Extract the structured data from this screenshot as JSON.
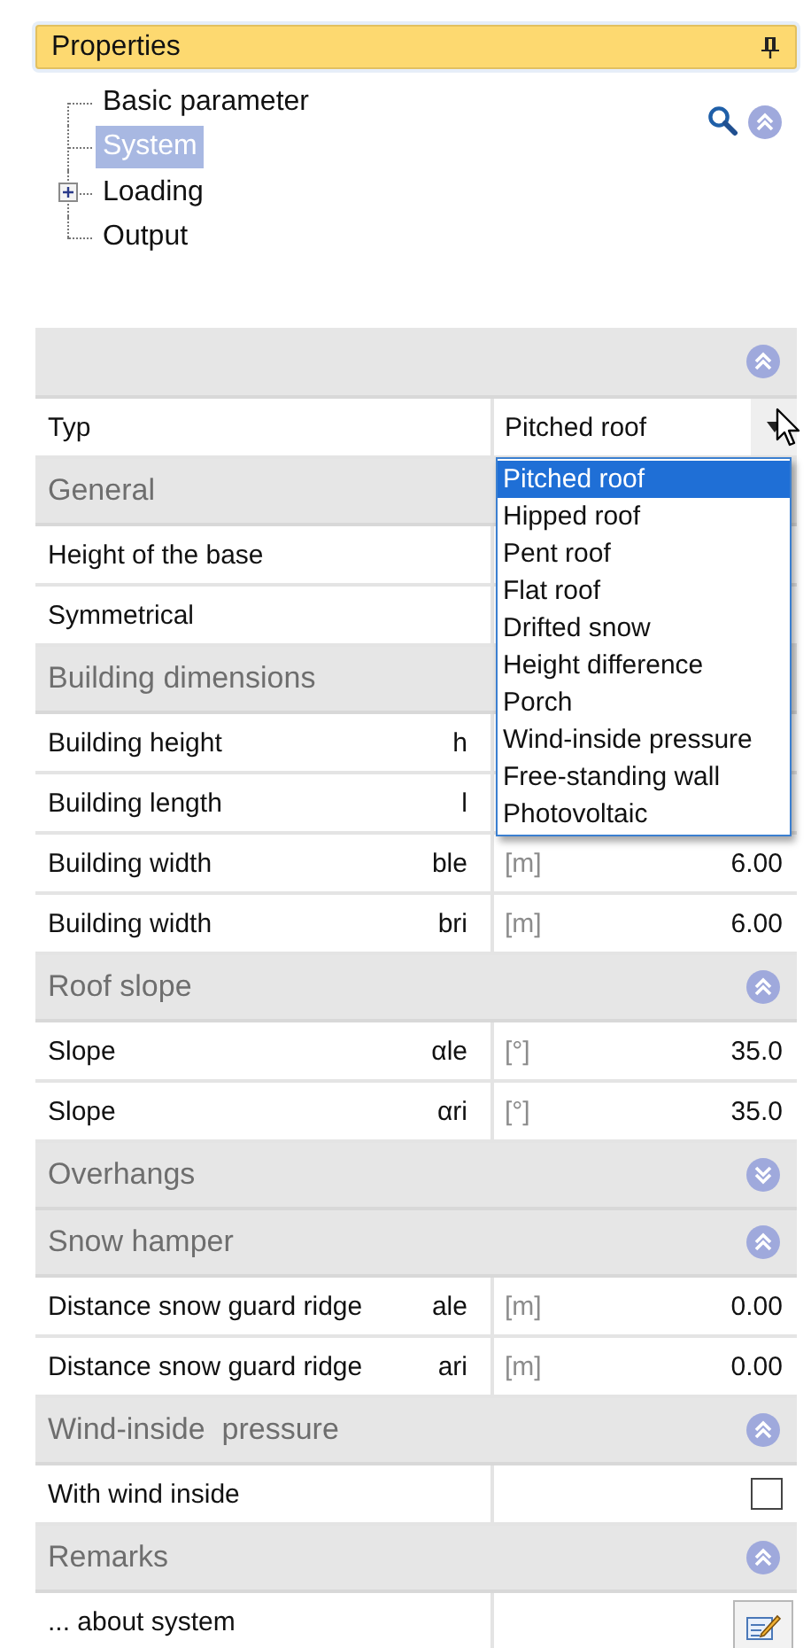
{
  "panel": {
    "title": "Properties"
  },
  "tree": [
    {
      "label": "Basic parameter",
      "kind": "leaf",
      "selected": false
    },
    {
      "label": "System",
      "kind": "leaf",
      "selected": true
    },
    {
      "label": "Loading",
      "kind": "folder",
      "expanded": false,
      "selected": false
    },
    {
      "label": "Output",
      "kind": "leaf",
      "selected": false
    }
  ],
  "grid": {
    "expanded": true,
    "rows": [
      {
        "kind": "select",
        "label": "Typ",
        "value": "Pitched roof",
        "open": true,
        "options": [
          {
            "label": "Pitched roof",
            "selected": true
          },
          {
            "label": "Hipped roof",
            "selected": false
          },
          {
            "label": "Pent roof",
            "selected": false
          },
          {
            "label": "Flat roof",
            "selected": false
          },
          {
            "label": "Drifted snow",
            "selected": false
          },
          {
            "label": "Height difference",
            "selected": false
          },
          {
            "label": "Porch",
            "selected": false
          },
          {
            "label": "Wind-inside  pressure",
            "selected": false
          },
          {
            "label": "Free-standing wall",
            "selected": false
          },
          {
            "label": "Photovoltaic",
            "selected": false
          }
        ]
      },
      {
        "kind": "group",
        "title": "General"
      },
      {
        "kind": "value",
        "label": "Height of the base"
      },
      {
        "kind": "value",
        "label": "Symmetrical"
      },
      {
        "kind": "group",
        "title": "Building dimensions"
      },
      {
        "kind": "value",
        "label": "Building height",
        "symbol": "h"
      },
      {
        "kind": "value",
        "label": "Building length",
        "symbol": "l"
      },
      {
        "kind": "value",
        "label": "Building width",
        "symbol": "ble",
        "unit": "[m]",
        "value": "6.00"
      },
      {
        "kind": "value",
        "label": "Building width",
        "symbol": "bri",
        "unit": "[m]",
        "value": "6.00"
      },
      {
        "kind": "group",
        "title": "Roof slope",
        "expanded": true
      },
      {
        "kind": "value",
        "label": "Slope",
        "symbol": "αle",
        "unit": "[°]",
        "value": "35.0"
      },
      {
        "kind": "value",
        "label": "Slope",
        "symbol": "αri",
        "unit": "[°]",
        "value": "35.0"
      },
      {
        "kind": "group",
        "title": "Overhangs",
        "expanded": false
      },
      {
        "kind": "group",
        "title": "Snow hamper",
        "expanded": true
      },
      {
        "kind": "value",
        "label": "Distance snow guard ridge",
        "symbol": "ale",
        "unit": "[m]",
        "value": "0.00"
      },
      {
        "kind": "value",
        "label": "Distance snow guard ridge",
        "symbol": "ari",
        "unit": "[m]",
        "value": "0.00"
      },
      {
        "kind": "group",
        "title": "Wind-inside  pressure",
        "expanded": true
      },
      {
        "kind": "checkbox",
        "label": "With wind inside",
        "checked": false
      },
      {
        "kind": "group",
        "title": "Remarks",
        "expanded": true
      },
      {
        "kind": "button",
        "label": "... about system"
      }
    ]
  }
}
